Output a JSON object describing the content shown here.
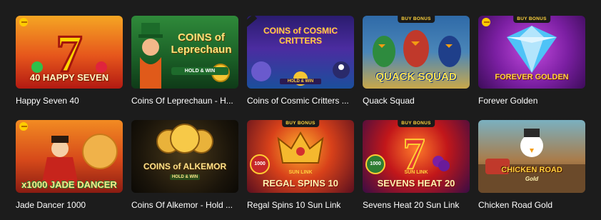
{
  "games": [
    {
      "title": "Happy Seven 40",
      "badge": "",
      "art_text": "40 HAPPY SEVEN"
    },
    {
      "title": "Coins Of Leprechaun - H...",
      "badge": "",
      "art_text": "COINS of Leprechaun",
      "art_sub": "HOLD & WIN"
    },
    {
      "title": "Coins of Cosmic Critters ...",
      "badge": "",
      "art_text": "COINS of COSMIC CRITTERS",
      "art_sub": "HOLD & WIN"
    },
    {
      "title": "Quack Squad",
      "badge": "BUY BONUS",
      "art_text": "QUACK SQUAD"
    },
    {
      "title": "Forever Golden",
      "badge": "BUY BONUS",
      "art_text": "FOREVER GOLDEN"
    },
    {
      "title": "Jade Dancer 1000",
      "badge": "",
      "art_text": "x1000 JADE DANCER"
    },
    {
      "title": "Coins Of Alkemor - Hold ...",
      "badge": "",
      "art_text": "COINS of ALKEMOR",
      "art_sub": "HOLD & WIN"
    },
    {
      "title": "Regal Spins 10 Sun Link",
      "badge": "BUY BONUS",
      "art_text": "REGAL SPINS 10",
      "art_sub": "SUN LINK",
      "art_num": "1000"
    },
    {
      "title": "Sevens Heat 20 Sun Link",
      "badge": "BUY BONUS",
      "art_text": "SEVENS HEAT 20",
      "art_sub": "SUN LINK",
      "art_num": "1000"
    },
    {
      "title": "Chicken Road Gold",
      "badge": "",
      "art_text": "CHICKEN ROAD",
      "art_sub": "Gold"
    }
  ],
  "colors": {
    "background": "#1c1c1c",
    "title_text": "#ffffff",
    "badge_text": "#ffd33d"
  }
}
